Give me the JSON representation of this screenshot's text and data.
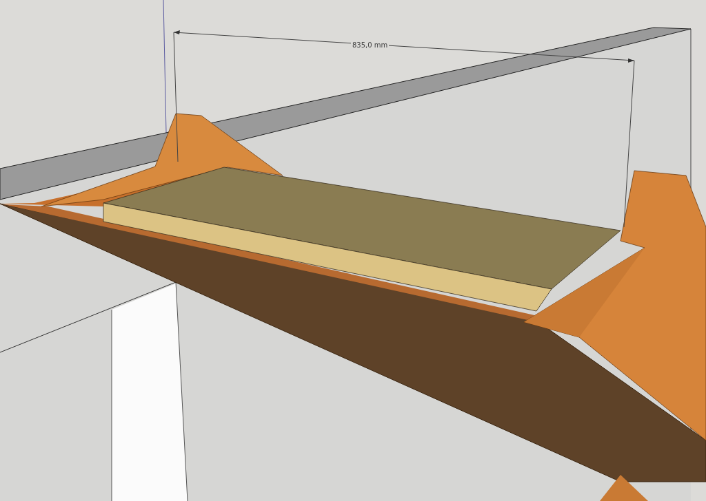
{
  "dimension": {
    "label": "835,0 mm"
  }
}
